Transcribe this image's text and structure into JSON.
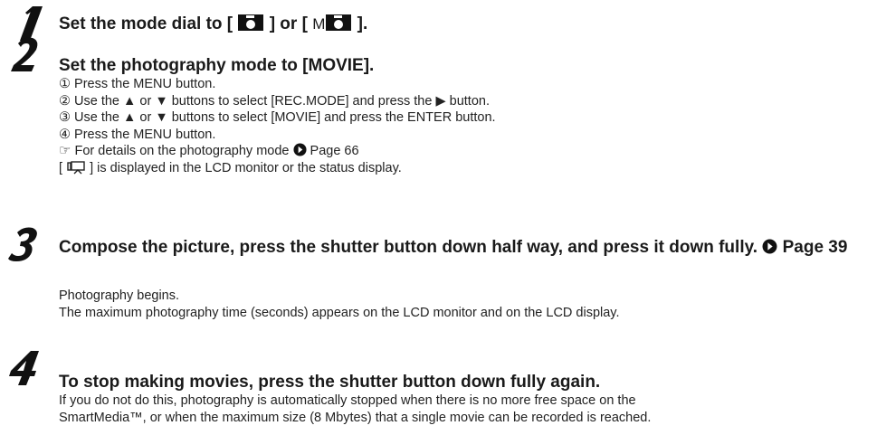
{
  "step1": {
    "number": "1",
    "prefix": "Set the mode dial to [",
    "mid": "] or [",
    "m_letter": "M",
    "suffix": "]."
  },
  "step2": {
    "number": "2",
    "title": "Set the photography mode to [MOVIE].",
    "lines": [
      "① Press the MENU button.",
      "② Use the ▲ or ▼ buttons to select [REC.MODE] and press the ▶ button.",
      "③ Use the ▲ or ▼ buttons to select [MOVIE] and press the ENTER button.",
      "④ Press the MENU button."
    ],
    "ref_hand": "☞",
    "ref_text": "For details on the photography mode",
    "ref_page": "Page 66",
    "display_pre": "[",
    "display_post": "] is displayed in the LCD monitor or the status display."
  },
  "step3": {
    "number": "3",
    "title": "Compose the picture, press the shutter button down half way, and press it down fully.",
    "title_page": "Page 39",
    "lines": [
      "Photography begins.",
      "The maximum photography time (seconds) appears on the LCD monitor and on the LCD display."
    ]
  },
  "step4": {
    "number": "4",
    "title": "To stop making movies, press the shutter button down fully again.",
    "lines": [
      "If you do not do this, photography is automatically stopped when there is no more free space on the",
      "SmartMedia™, or when the maximum size (8 Mbytes) that a single movie can be recorded is reached."
    ]
  }
}
